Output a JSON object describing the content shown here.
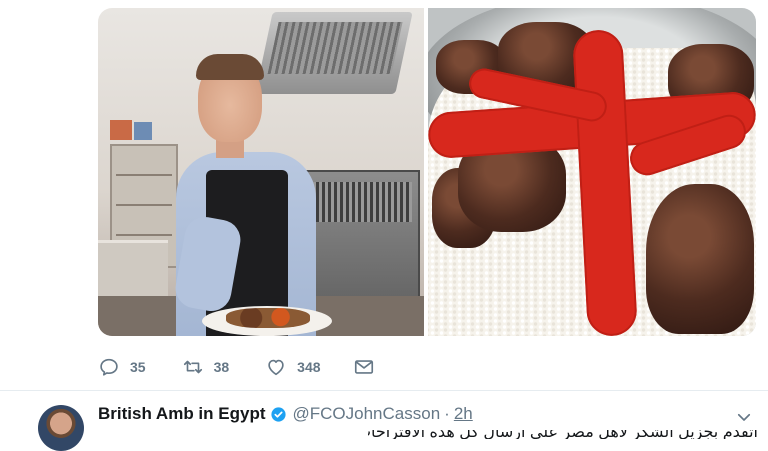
{
  "media": {
    "left_photo": "chef-in-kitchen-photo",
    "right_photo": "rice-meat-dish-photo"
  },
  "actions": {
    "reply": {
      "icon": "reply-icon",
      "count": "35"
    },
    "retweet": {
      "icon": "retweet-icon",
      "count": "38"
    },
    "like": {
      "icon": "heart-icon",
      "count": "348"
    },
    "dm": {
      "icon": "envelope-icon"
    }
  },
  "next_tweet": {
    "name": "British Amb in Egypt",
    "verified_icon": "verified-badge-icon",
    "handle": "@FCOJohnCasson",
    "separator": "·",
    "time": "2h",
    "text_partial": "اتقدم بجزيل الشكر لأهل مصر على ارسال كل هذه الاقتراحات بخصوص الطبخ"
  },
  "colors": {
    "secondary_text": "#657786",
    "divider": "#e6ecf0",
    "verified": "#1da1f2",
    "sauce_red": "#d8281d"
  }
}
